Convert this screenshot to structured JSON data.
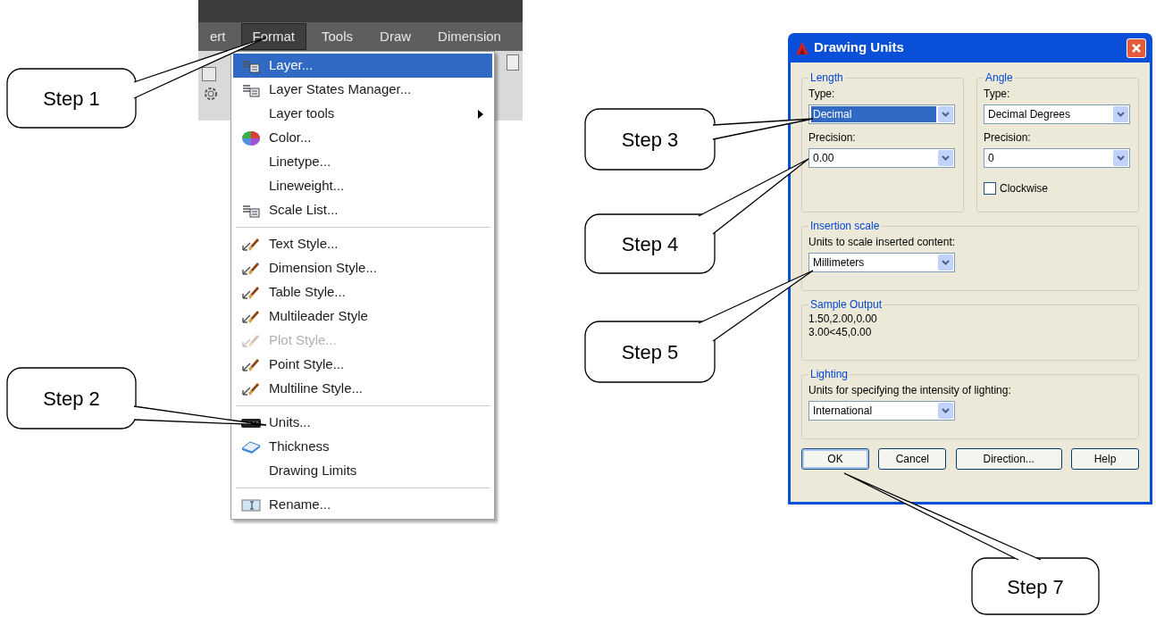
{
  "menubar": {
    "items": [
      {
        "label": "ert",
        "selected": false
      },
      {
        "label": "Format",
        "selected": true
      },
      {
        "label": "Tools",
        "selected": false
      },
      {
        "label": "Draw",
        "selected": false
      },
      {
        "label": "Dimension",
        "selected": false
      }
    ]
  },
  "format_menu": {
    "items": [
      {
        "kind": "item",
        "label": "Layer...",
        "selected": true,
        "disabled": false,
        "submenu": false
      },
      {
        "kind": "item",
        "label": "Layer States Manager...",
        "selected": false,
        "disabled": false,
        "submenu": false
      },
      {
        "kind": "item",
        "label": "Layer tools",
        "selected": false,
        "disabled": false,
        "submenu": true
      },
      {
        "kind": "item",
        "label": "Color...",
        "selected": false,
        "disabled": false,
        "submenu": false
      },
      {
        "kind": "item",
        "label": "Linetype...",
        "selected": false,
        "disabled": false,
        "submenu": false
      },
      {
        "kind": "item",
        "label": "Lineweight...",
        "selected": false,
        "disabled": false,
        "submenu": false
      },
      {
        "kind": "item",
        "label": "Scale List...",
        "selected": false,
        "disabled": false,
        "submenu": false
      },
      {
        "kind": "separator"
      },
      {
        "kind": "item",
        "label": "Text Style...",
        "selected": false,
        "disabled": false,
        "submenu": false
      },
      {
        "kind": "item",
        "label": "Dimension Style...",
        "selected": false,
        "disabled": false,
        "submenu": false
      },
      {
        "kind": "item",
        "label": "Table Style...",
        "selected": false,
        "disabled": false,
        "submenu": false
      },
      {
        "kind": "item",
        "label": "Multileader Style",
        "selected": false,
        "disabled": false,
        "submenu": false
      },
      {
        "kind": "item",
        "label": "Plot Style...",
        "selected": false,
        "disabled": true,
        "submenu": false
      },
      {
        "kind": "item",
        "label": "Point Style...",
        "selected": false,
        "disabled": false,
        "submenu": false
      },
      {
        "kind": "item",
        "label": "Multiline Style...",
        "selected": false,
        "disabled": false,
        "submenu": false
      },
      {
        "kind": "separator"
      },
      {
        "kind": "item",
        "label": "Units...",
        "selected": false,
        "disabled": false,
        "submenu": false
      },
      {
        "kind": "item",
        "label": "Thickness",
        "selected": false,
        "disabled": false,
        "submenu": false
      },
      {
        "kind": "item",
        "label": "Drawing Limits",
        "selected": false,
        "disabled": false,
        "submenu": false
      },
      {
        "kind": "separator"
      },
      {
        "kind": "item",
        "label": "Rename...",
        "selected": false,
        "disabled": false,
        "submenu": false
      }
    ]
  },
  "dialog": {
    "title": "Drawing Units",
    "length": {
      "title": "Length",
      "type_label": "Type:",
      "type": {
        "value": "Decimal",
        "highlighted": true
      },
      "precision_label": "Precision:",
      "precision": {
        "value": "0.00",
        "highlighted": false
      }
    },
    "angle": {
      "title": "Angle",
      "type_label": "Type:",
      "type": {
        "value": "Decimal Degrees",
        "highlighted": false
      },
      "precision_label": "Precision:",
      "precision": {
        "value": "0",
        "highlighted": false
      },
      "clockwise": {
        "label": "Clockwise",
        "checked": false
      }
    },
    "insertion_scale": {
      "title": "Insertion scale",
      "label": "Units to scale inserted content:",
      "units": {
        "value": "Millimeters",
        "highlighted": false
      }
    },
    "sample_output": {
      "title": "Sample Output",
      "lines": [
        "1.50,2.00,0.00",
        "3.00<45,0.00"
      ]
    },
    "lighting": {
      "title": "Lighting",
      "label": "Units for specifying the intensity of lighting:",
      "units": {
        "value": "International",
        "highlighted": false
      }
    },
    "buttons": [
      {
        "label": "OK",
        "default": true
      },
      {
        "label": "Cancel",
        "default": false
      },
      {
        "label": "Direction...",
        "default": false
      },
      {
        "label": "Help",
        "default": false
      }
    ]
  },
  "callouts": [
    {
      "label": "Step 1"
    },
    {
      "label": "Step 2"
    },
    {
      "label": "Step 3"
    },
    {
      "label": "Step 4"
    },
    {
      "label": "Step 5"
    },
    {
      "label": "Step 7"
    }
  ]
}
